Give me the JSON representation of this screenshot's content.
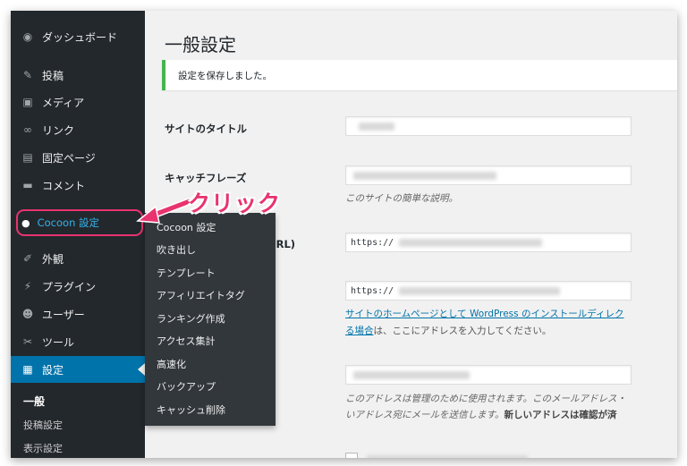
{
  "sidebar": {
    "items": [
      {
        "label": "ダッシュボード",
        "icon": "dashboard-icon",
        "glyph": "◉"
      },
      {
        "label": "投稿",
        "icon": "pin-icon",
        "glyph": "✎"
      },
      {
        "label": "メディア",
        "icon": "media-icon",
        "glyph": "▣"
      },
      {
        "label": "リンク",
        "icon": "link-icon",
        "glyph": "∞"
      },
      {
        "label": "固定ページ",
        "icon": "page-icon",
        "glyph": "▤"
      },
      {
        "label": "コメント",
        "icon": "comment-icon",
        "glyph": "▬"
      },
      {
        "label": "Cocoon 設定",
        "icon": "cocoon-icon",
        "glyph": "●"
      },
      {
        "label": "外観",
        "icon": "appearance-icon",
        "glyph": "✐"
      },
      {
        "label": "プラグイン",
        "icon": "plugin-icon",
        "glyph": "⚡"
      },
      {
        "label": "ユーザー",
        "icon": "user-icon",
        "glyph": "☻"
      },
      {
        "label": "ツール",
        "icon": "tool-icon",
        "glyph": "✂"
      },
      {
        "label": "設定",
        "icon": "settings-icon",
        "glyph": "▦"
      }
    ],
    "submenu": [
      {
        "label": "一般",
        "current": true
      },
      {
        "label": "投稿設定"
      },
      {
        "label": "表示設定"
      }
    ]
  },
  "flyout": {
    "items": [
      "Cocoon 設定",
      "吹き出し",
      "テンプレート",
      "アフィリエイトタグ",
      "ランキング作成",
      "アクセス集計",
      "高速化",
      "バックアップ",
      "キャッシュ削除"
    ]
  },
  "main": {
    "title": "一般設定",
    "notice": "設定を保存しました。",
    "site_title_label": "サイトのタイトル",
    "tagline_label": "キャッチフレーズ",
    "tagline_desc": "このサイトの簡単な説明。",
    "wp_address_label_suffix": "(URL)",
    "wp_address_value": "https://",
    "site_address_value": "https://",
    "site_address_desc_link": "サイトのホームページとして WordPress のインストールディレク",
    "site_address_desc_link2": "る場合",
    "site_address_desc_tail": "は、ここにアドレスを入力してください。",
    "email_desc_1": "このアドレスは管理のために使用されます。このメールアドレス・",
    "email_desc_2a": "いアドレス宛にメールを送信します。",
    "email_desc_2b": "新しいアドレスは確認が済"
  },
  "annotation": {
    "text": "クリック",
    "color": "#e8336e"
  },
  "colors": {
    "sidebar_bg": "#23282d",
    "active_bg": "#0073aa",
    "flyout_bg": "#32373c",
    "notice_border": "#46b450",
    "cocoon_label": "#33b3ea"
  }
}
